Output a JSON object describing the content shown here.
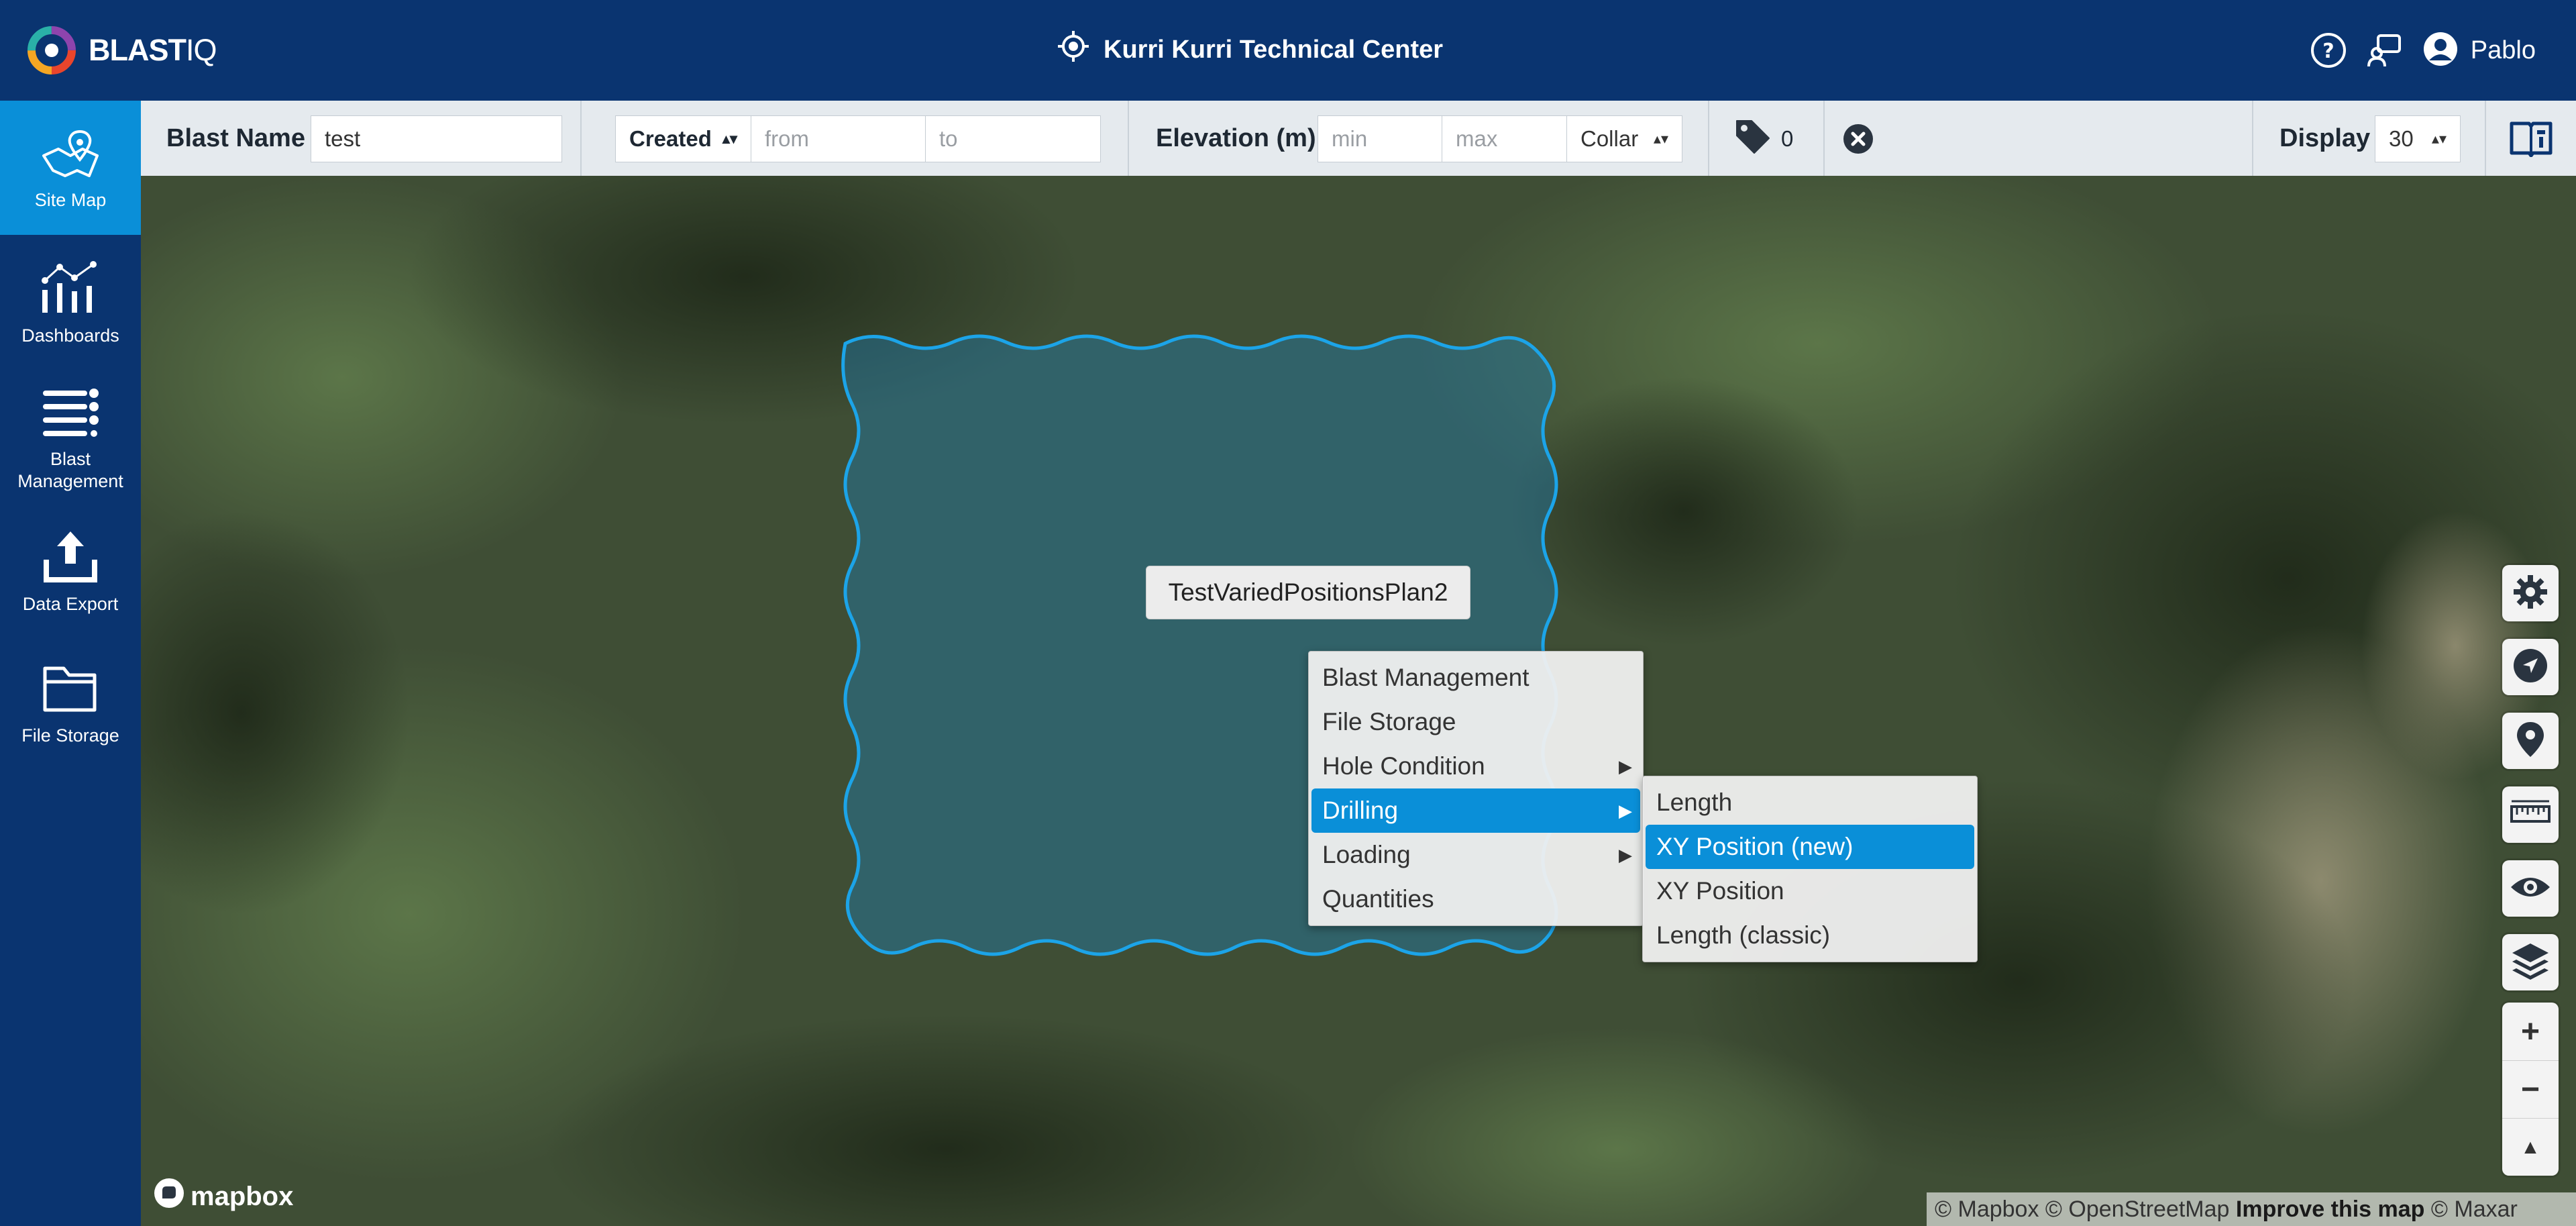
{
  "header": {
    "logo_text": "BLAST",
    "logo_text_suffix": "IQ",
    "site_name": "Kurri Kurri Technical Center",
    "user_name": "Pablo",
    "icons": [
      "help-icon",
      "notifications-icon",
      "user-icon",
      "location-target-icon"
    ]
  },
  "sidebar": {
    "items": [
      {
        "label": "Site Map",
        "icon": "map-icon",
        "active": true
      },
      {
        "label": "Dashboards",
        "icon": "dashboard-chart-icon",
        "active": false
      },
      {
        "label": "Blast Management",
        "icon": "list-icon",
        "active": false
      },
      {
        "label": "Data Export",
        "icon": "upload-icon",
        "active": false
      },
      {
        "label": "File Storage",
        "icon": "folder-icon",
        "active": false
      }
    ]
  },
  "toolbar": {
    "blast_name_label": "Blast Name",
    "blast_name_value": "test",
    "created_select": "Created",
    "from_placeholder": "from",
    "to_placeholder": "to",
    "elevation_label": "Elevation (m)",
    "min_placeholder": "min",
    "max_placeholder": "max",
    "collar_select": "Collar",
    "tag_count": "0",
    "display_label": "Display",
    "display_value": "30"
  },
  "map": {
    "plan_label": "TestVariedPositionsPlan2",
    "context_menu": [
      {
        "label": "Blast Management",
        "submenu": false
      },
      {
        "label": "File Storage",
        "submenu": false
      },
      {
        "label": "Hole Condition",
        "submenu": true
      },
      {
        "label": "Drilling",
        "submenu": true,
        "highlighted": true
      },
      {
        "label": "Loading",
        "submenu": true
      },
      {
        "label": "Quantities",
        "submenu": false
      }
    ],
    "submenu": [
      {
        "label": "Length"
      },
      {
        "label": "XY Position (new)",
        "highlighted": true
      },
      {
        "label": "XY Position"
      },
      {
        "label": "Length (classic)"
      }
    ],
    "controls": [
      "gear-icon",
      "navigate-icon",
      "pin-icon",
      "ruler-icon",
      "eye-icon",
      "layers-icon"
    ],
    "zoom_in": "+",
    "zoom_out": "−",
    "compass": "▲",
    "mapbox_logo": "mapbox",
    "attribution": {
      "mapbox": "© Mapbox",
      "osm": "© OpenStreetMap",
      "improve": "Improve this map",
      "maxar": "© Maxar"
    }
  },
  "colors": {
    "header_bg": "#0a3470",
    "accent": "#0a8fd8",
    "toolbar_bg": "#e5eaee",
    "polygon_stroke": "#1ca4e8"
  }
}
